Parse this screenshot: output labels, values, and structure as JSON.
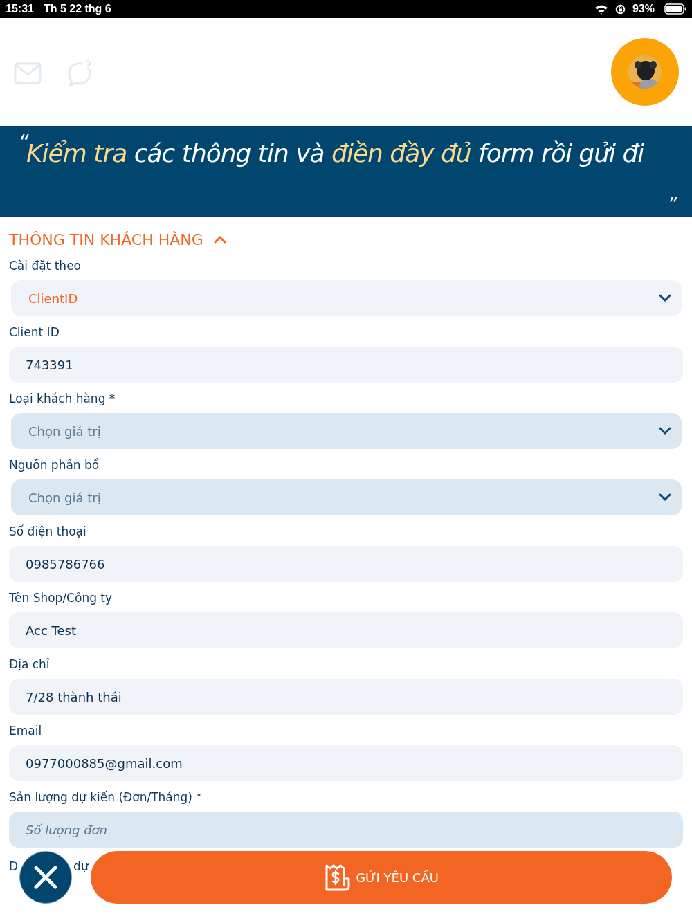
{
  "status_bar": {
    "time": "15:31",
    "date": "Th 5 22 thg 6",
    "battery_text": "93%"
  },
  "banner": {
    "open_quote": "“",
    "close_quote": "”",
    "segments": [
      {
        "text": "Kiểm tra",
        "highlight": true
      },
      {
        "text": " các thông tin và ",
        "highlight": false
      },
      {
        "text": "điền đầy đủ",
        "highlight": true
      },
      {
        "text": " form rồi gửi đi",
        "highlight": false
      }
    ]
  },
  "section": {
    "title": "THÔNG TIN KHÁCH HÀNG",
    "expanded": true
  },
  "fields": [
    {
      "label": "Cài đặt theo",
      "kind": "select",
      "value": "ClientID"
    },
    {
      "label": "Client ID",
      "kind": "input",
      "value": "743391"
    },
    {
      "label": "Loại khách hàng *",
      "kind": "select",
      "placeholder": "Chọn giá trị"
    },
    {
      "label": "Nguồn phân bổ",
      "kind": "select",
      "placeholder": "Chọn giá trị"
    },
    {
      "label": "Số điện thoại",
      "kind": "input",
      "value": "0985786766"
    },
    {
      "label": "Tên Shop/Công ty",
      "kind": "input",
      "value": "Acc Test"
    },
    {
      "label": "Địa chỉ",
      "kind": "input",
      "value": "7/28 thành thái"
    },
    {
      "label": "Email",
      "kind": "input",
      "value": "0977000885@gmail.com"
    },
    {
      "label": "Sản lượng dự kiến (Đơn/Tháng) *",
      "kind": "number",
      "placeholder": "Số lượng đơn"
    }
  ],
  "partial_label": [
    "D",
    "dự"
  ],
  "submit_button": {
    "label": "GỬI YÊU CẦU"
  }
}
